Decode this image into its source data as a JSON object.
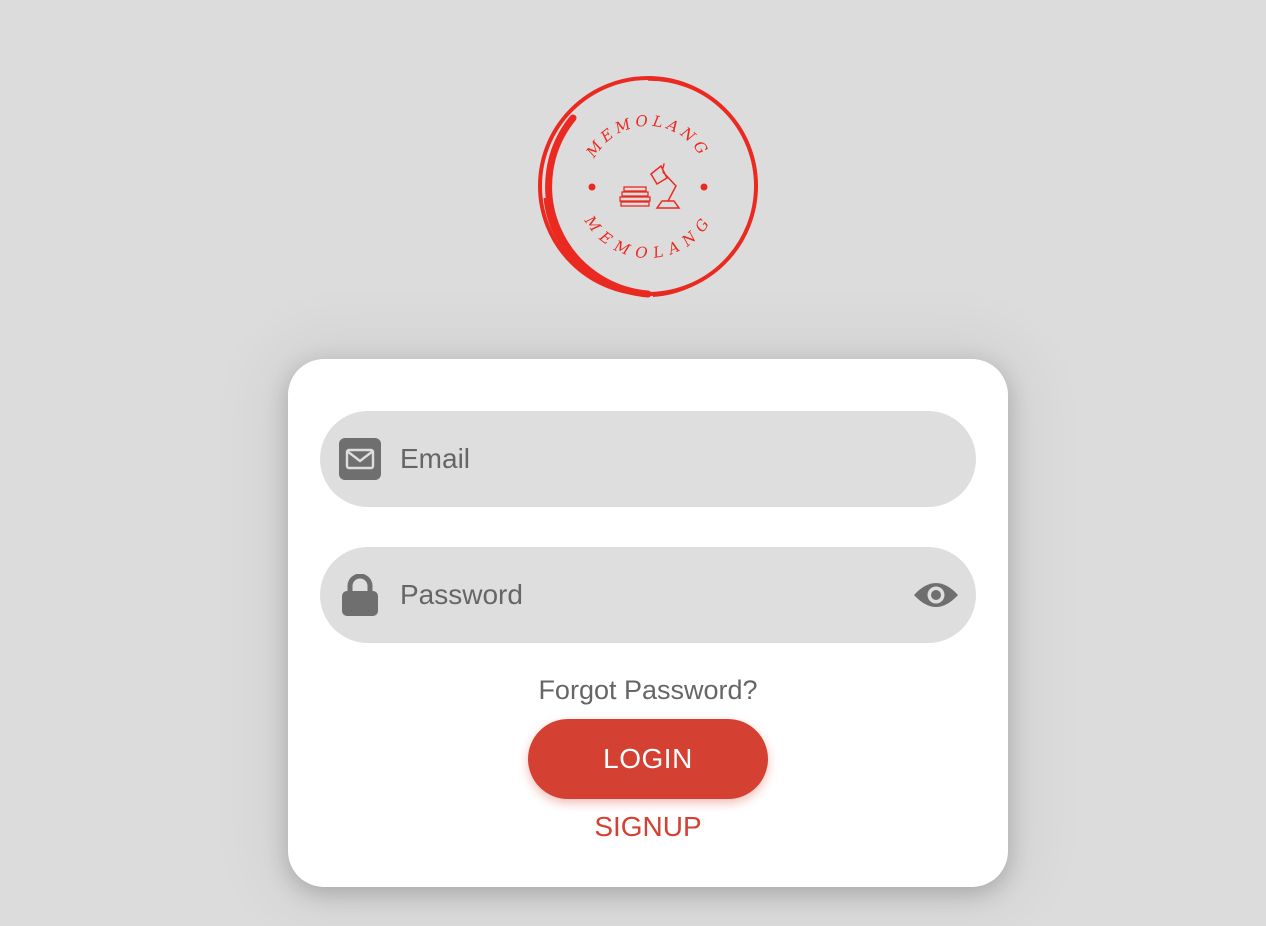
{
  "brand": {
    "logo_text": "MEMOLANG",
    "logo_color": "#ea2a20"
  },
  "login_form": {
    "email": {
      "placeholder": "Email",
      "value": "",
      "icon": "envelope-icon"
    },
    "password": {
      "placeholder": "Password",
      "value": "",
      "icon": "lock-icon",
      "toggle_icon": "eye-icon"
    },
    "forgot_password_label": "Forgot Password?",
    "login_label": "LOGIN",
    "signup_label": "SIGNUP"
  },
  "colors": {
    "background": "#dcdcdc",
    "accent": "#d44132",
    "field_background": "#dedede",
    "icon": "#6f6f6f"
  }
}
